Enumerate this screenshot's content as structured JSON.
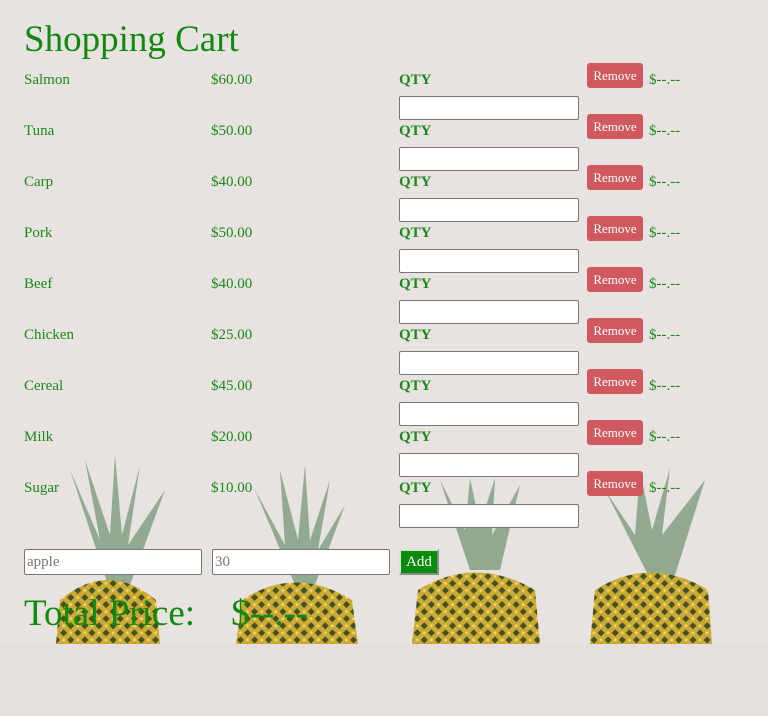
{
  "title": "Shopping Cart",
  "items": [
    {
      "name": "Salmon",
      "price": "$60.00",
      "qty_label": "QTY",
      "qty": "",
      "remove": "Remove",
      "subtotal": "$--.--"
    },
    {
      "name": "Tuna",
      "price": "$50.00",
      "qty_label": "QTY",
      "qty": "",
      "remove": "Remove",
      "subtotal": "$--.--"
    },
    {
      "name": "Carp",
      "price": "$40.00",
      "qty_label": "QTY",
      "qty": "",
      "remove": "Remove",
      "subtotal": "$--.--"
    },
    {
      "name": "Pork",
      "price": "$50.00",
      "qty_label": "QTY",
      "qty": "",
      "remove": "Remove",
      "subtotal": "$--.--"
    },
    {
      "name": "Beef",
      "price": "$40.00",
      "qty_label": "QTY",
      "qty": "",
      "remove": "Remove",
      "subtotal": "$--.--"
    },
    {
      "name": "Chicken",
      "price": "$25.00",
      "qty_label": "QTY",
      "qty": "",
      "remove": "Remove",
      "subtotal": "$--.--"
    },
    {
      "name": "Cereal",
      "price": "$45.00",
      "qty_label": "QTY",
      "qty": "",
      "remove": "Remove",
      "subtotal": "$--.--"
    },
    {
      "name": "Milk",
      "price": "$20.00",
      "qty_label": "QTY",
      "qty": "",
      "remove": "Remove",
      "subtotal": "$--.--"
    },
    {
      "name": "Sugar",
      "price": "$10.00",
      "qty_label": "QTY",
      "qty": "",
      "remove": "Remove",
      "subtotal": "$--.--"
    }
  ],
  "add_form": {
    "name_placeholder": "apple",
    "price_placeholder": "30",
    "add_label": "Add"
  },
  "total": {
    "label": "Total Price:",
    "value": "$--.--"
  },
  "colors": {
    "text": "#1a8a1a",
    "remove": "#d0595f",
    "add": "#0b8a0b",
    "background": "#e8e2e0"
  }
}
